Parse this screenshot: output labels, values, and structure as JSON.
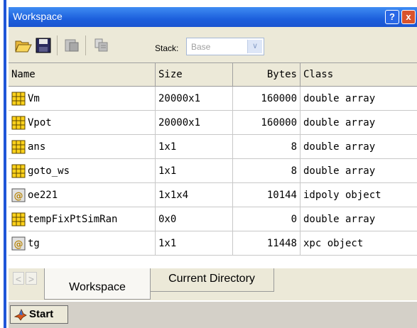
{
  "window": {
    "title": "Workspace",
    "help_label": "?",
    "close_label": "x"
  },
  "toolbar": {
    "stack_label": "Stack:",
    "stack_value": "Base"
  },
  "table": {
    "columns": [
      "Name",
      "Size",
      "Bytes",
      "Class"
    ],
    "rows": [
      {
        "name": "Vm",
        "size": "20000x1",
        "bytes": "160000",
        "class": "double array",
        "icon": "matrix-icon"
      },
      {
        "name": "Vpot",
        "size": "20000x1",
        "bytes": "160000",
        "class": "double array",
        "icon": "matrix-icon"
      },
      {
        "name": "ans",
        "size": "1x1",
        "bytes": "8",
        "class": "double array",
        "icon": "matrix-icon"
      },
      {
        "name": "goto_ws",
        "size": "1x1",
        "bytes": "8",
        "class": "double array",
        "icon": "matrix-icon"
      },
      {
        "name": "oe221",
        "size": "1x1x4",
        "bytes": "10144",
        "class": "idpoly object",
        "icon": "object-icon"
      },
      {
        "name": "tempFixPtSimRan",
        "size": "0x0",
        "bytes": "0",
        "class": "double array",
        "icon": "matrix-icon"
      },
      {
        "name": "tg",
        "size": "1x1",
        "bytes": "11448",
        "class": "xpc object",
        "icon": "object-icon"
      }
    ]
  },
  "tabs": {
    "workspace": "Workspace",
    "current_directory": "Current Directory"
  },
  "statusbar": {
    "start_label": "Start"
  },
  "colors": {
    "title_blue": "#1c5fdc",
    "matrix_yellow": "#ffd21a",
    "chrome": "#ece9d8"
  }
}
